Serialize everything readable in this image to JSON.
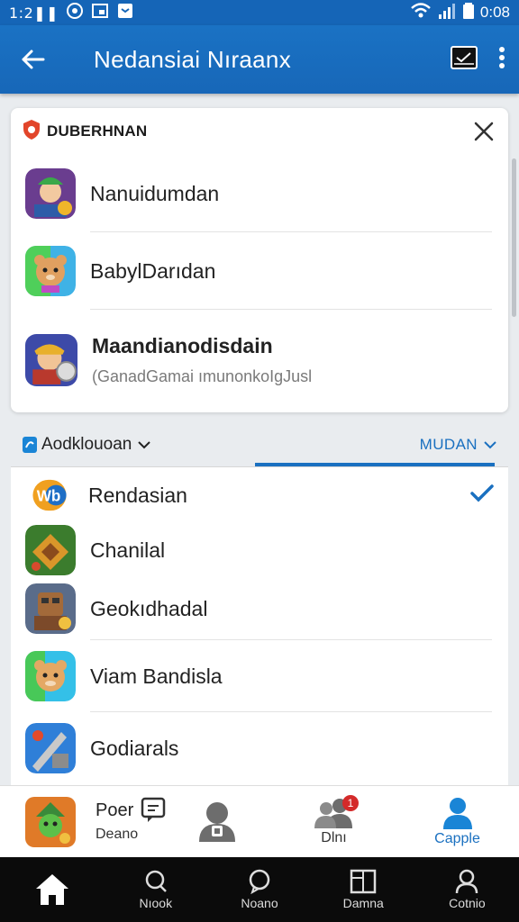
{
  "status_bar": {
    "time": "1:2❚❚ ",
    "battery_text": "0:08"
  },
  "app_bar": {
    "title": "Nedansiai Nıraanx"
  },
  "suggestions": {
    "header": "DUBERHNAN",
    "items": [
      {
        "name": "Nanuidumdan",
        "icon": "warrior-game-icon"
      },
      {
        "name": "BabylDarıdan",
        "icon": "hamster-game-icon"
      },
      {
        "name": "Maandianodisdain",
        "subtitle": "(GanadGamai ımunonkoIgJusl",
        "icon": "viking-game-icon"
      }
    ]
  },
  "sort": {
    "left_label": "Aodklouoan",
    "right_label": "MUDAN"
  },
  "list": {
    "items": [
      {
        "name": "Rendasian",
        "checked": true,
        "icon": "wb-logo-icon"
      },
      {
        "name": "Chanilal",
        "checked": false,
        "icon": "dragon-game-icon"
      },
      {
        "name": "Geokıdhadal",
        "checked": false,
        "icon": "robot-game-icon"
      },
      {
        "name": "Viam Bandisla",
        "checked": false,
        "icon": "hamster-game-icon"
      },
      {
        "name": "Godiarals",
        "checked": false,
        "icon": "knight-game-icon"
      }
    ]
  },
  "bottom_tabs": [
    {
      "label": "Poer",
      "sub": "Deano",
      "icon": "game-avatar-icon"
    },
    {
      "label": "",
      "icon": "person-lock-icon"
    },
    {
      "label": "Dlnı",
      "icon": "group-icon",
      "badge": "1"
    },
    {
      "label": "Capple",
      "icon": "profile-icon",
      "active": true
    }
  ],
  "system_nav": [
    {
      "label": "",
      "icon": "home-icon"
    },
    {
      "label": "Nıook",
      "icon": "search-icon"
    },
    {
      "label": "Noano",
      "icon": "chat-icon"
    },
    {
      "label": "Damna",
      "icon": "library-icon"
    },
    {
      "label": "Cotnio",
      "icon": "account-icon"
    }
  ],
  "colors": {
    "primary": "#1767b8",
    "accent": "#1a70c0",
    "badge": "#d42a2a"
  }
}
